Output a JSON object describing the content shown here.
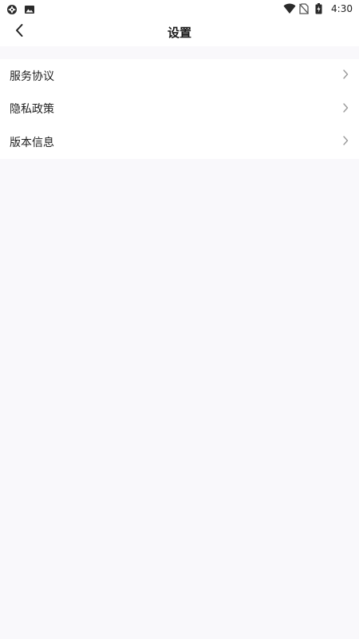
{
  "status_bar": {
    "time": "4:30",
    "left_icons": [
      "sync-icon",
      "image-icon"
    ],
    "right_icons": [
      "wifi-icon",
      "no-sim-icon",
      "battery-charging-icon"
    ]
  },
  "header": {
    "title": "设置",
    "back_icon": "back-arrow-icon"
  },
  "menu": {
    "items": [
      {
        "label": "服务协议",
        "icon": "chevron-right-icon"
      },
      {
        "label": "隐私政策",
        "icon": "chevron-right-icon"
      },
      {
        "label": "版本信息",
        "icon": "chevron-right-icon"
      }
    ]
  },
  "colors": {
    "background": "#f9f8fb",
    "surface": "#ffffff",
    "text": "#222222",
    "chevron": "#9a9a9a"
  }
}
